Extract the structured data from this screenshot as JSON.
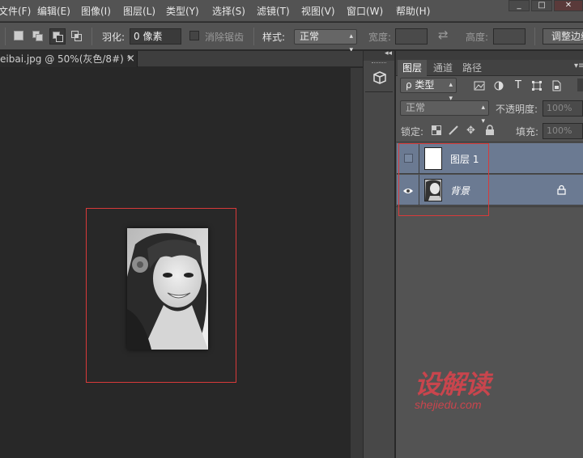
{
  "menu": {
    "items": [
      "文件(F)",
      "编辑(E)",
      "图像(I)",
      "图层(L)",
      "类型(Y)",
      "选择(S)",
      "滤镜(T)",
      "视图(V)",
      "窗口(W)",
      "帮助(H)"
    ],
    "window_controls": [
      "_",
      "□",
      "✕"
    ]
  },
  "options": {
    "feather_label": "羽化:",
    "feather_value": "0 像素",
    "antialias_label": "消除锯齿",
    "style_label": "样式:",
    "style_value": "正常",
    "width_label": "宽度:",
    "height_label": "高度:",
    "refine_edge_label": "调整边缘"
  },
  "document": {
    "tab_title": "eibai.jpg @ 50%(灰色/8#) *",
    "tab_close": "×"
  },
  "layers_panel": {
    "collapse_arrows": "◂◂",
    "tabs": [
      "图层",
      "通道",
      "路径"
    ],
    "filter_label": "ρ 类型",
    "blend_mode": "正常",
    "opacity_label": "不透明度:",
    "opacity_value": "100%",
    "lock_label": "锁定:",
    "fill_label": "填充:",
    "fill_value": "100%",
    "layers": [
      {
        "name": "图层 1",
        "visible": false,
        "locked": false
      },
      {
        "name": "背景",
        "visible": true,
        "locked": true
      }
    ]
  },
  "watermark": {
    "brand": "设解读",
    "url": "shejiedu.com"
  },
  "colors": {
    "ui_bg": "#535353",
    "canvas_bg": "#282828",
    "layer_selected": "#6b7a92",
    "annotation_red": "#d83a3a",
    "watermark_red": "#c8454d"
  }
}
